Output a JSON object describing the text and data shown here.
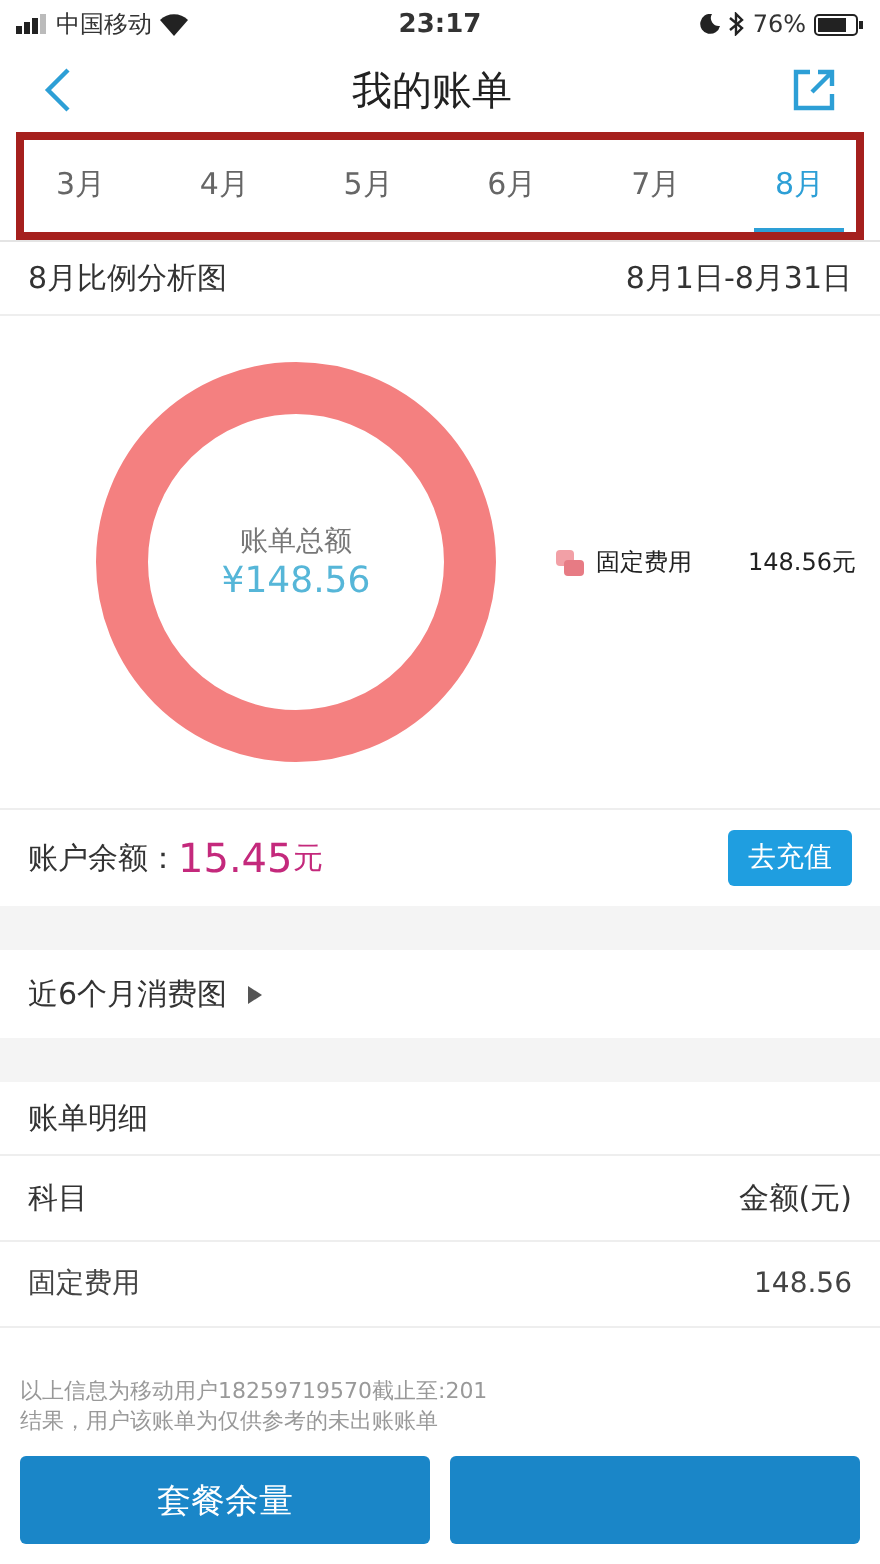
{
  "status_bar": {
    "carrier": "中国移动",
    "time": "23:17",
    "battery": "76%"
  },
  "nav": {
    "title": "我的账单"
  },
  "tabs": [
    {
      "label": "3月",
      "selected": false
    },
    {
      "label": "4月",
      "selected": false
    },
    {
      "label": "5月",
      "selected": false
    },
    {
      "label": "6月",
      "selected": false
    },
    {
      "label": "7月",
      "selected": false
    },
    {
      "label": "8月",
      "selected": true
    }
  ],
  "analysis": {
    "title": "8月比例分析图",
    "range": "8月1日-8月31日",
    "center_label": "账单总额",
    "center_amount": "¥148.56",
    "legend": [
      {
        "label": "固定费用",
        "amount": "148.56元",
        "color": "#f48080"
      }
    ]
  },
  "balance": {
    "label": "账户余额：",
    "amount": "15.45",
    "unit": "元",
    "button": "去充值"
  },
  "trend_link": "近6个月消费图",
  "details": {
    "title": "账单明细",
    "columns": [
      "科目",
      "金额(元)"
    ],
    "rows": [
      [
        "固定费用",
        "148.56"
      ]
    ]
  },
  "footnote": [
    "以上信息为移动用户18259719570截止至:201",
    "结果，用户该账单为仅供参考的未出账账单"
  ],
  "buttons": [
    {
      "kind": "labeled",
      "label": "套餐余量"
    },
    {
      "kind": "covered"
    }
  ]
}
